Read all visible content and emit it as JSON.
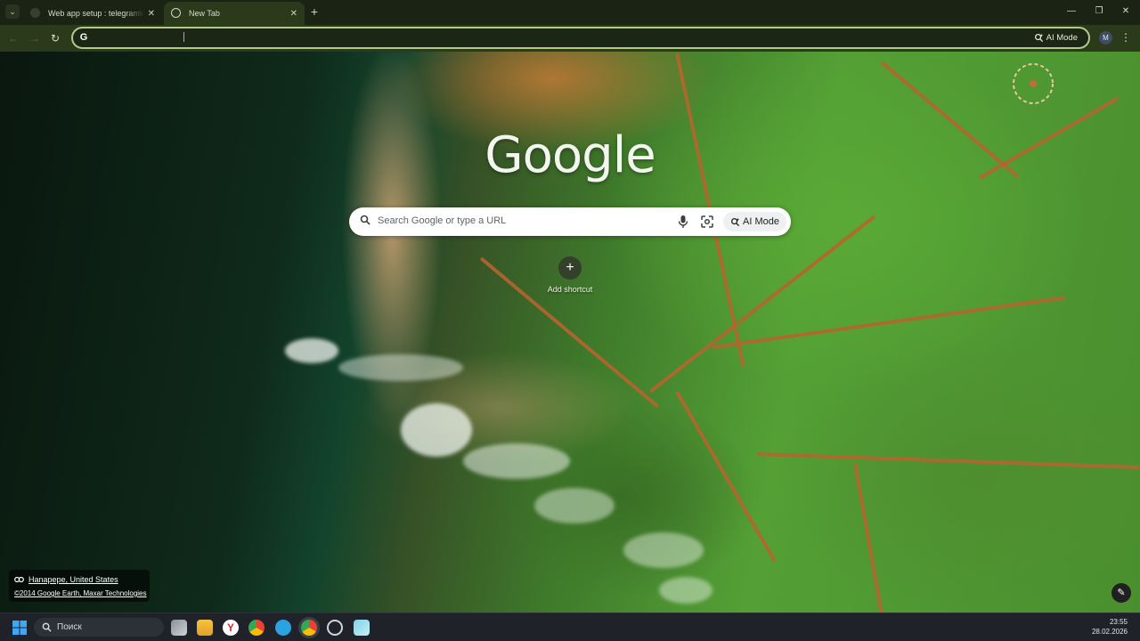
{
  "browser": {
    "tabs": [
      {
        "title": "Web app setup : telegramkanal!",
        "active": false
      },
      {
        "title": "New Tab",
        "active": true
      }
    ],
    "toolbar": {
      "omnibox_value": "",
      "ai_mode_label": "AI Mode",
      "profile_initial": "M"
    }
  },
  "newtab": {
    "logo_text": "Google",
    "search_placeholder": "Search Google or type a URL",
    "ai_mode_label": "AI Mode",
    "shortcut_label": "Add shortcut",
    "background": {
      "location": "Hanapepe, United States",
      "credit": "©2014 Google Earth, Maxar Technologies"
    }
  },
  "taskbar": {
    "search_label": "Поиск",
    "time": "23:55",
    "date": "28.02.2026",
    "apps": [
      "task-view",
      "file-explorer",
      "yandex-browser",
      "chrome",
      "telegram",
      "chrome-profile",
      "chatgpt",
      "notepad"
    ]
  },
  "colors": {
    "frame": "#1b2314",
    "toolbar": "#2c3a1c",
    "omnibox_border": "#b2c98c",
    "taskbar": "#1f2228"
  }
}
